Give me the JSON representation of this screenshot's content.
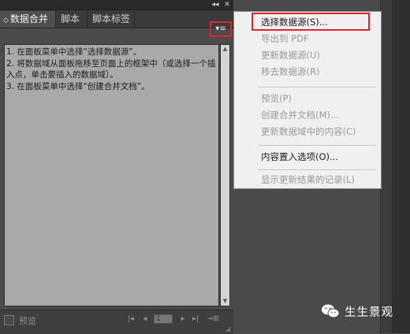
{
  "panel": {
    "collapse_icon": "◂◂",
    "close_icon": "✕",
    "tabs": [
      {
        "label": "数据合并",
        "arrows": "◇"
      },
      {
        "label": "脚本"
      },
      {
        "label": "脚本标签"
      }
    ],
    "menu_icon": "▾≡",
    "content_lines": [
      "1. 在面板菜单中选择“选择数据源”。",
      "2. 将数据域从面板拖移至页面上的框架中（或选择一个插入点，单击要插入的数据域）。",
      "3. 在面板菜单中选择“创建合并文档”。"
    ],
    "footer": {
      "preview_label": "预览",
      "record_value": "1",
      "first_icon": "|◂",
      "prev_icon": "◂",
      "next_icon": "▸",
      "last_icon": "▸|",
      "create_icon": "→⊞",
      "grip_icon": "◢"
    }
  },
  "menu": {
    "items": [
      {
        "label": "选择数据源(S)...",
        "enabled": true
      },
      {
        "label": "导出到 PDF",
        "enabled": false
      },
      {
        "label": "更新数据源(U)",
        "enabled": false
      },
      {
        "label": "移去数据源(R)",
        "enabled": false
      },
      {
        "label": "预览(P)",
        "enabled": false
      },
      {
        "label": "创建合并文档(M)...",
        "enabled": false
      },
      {
        "label": "更新数据域中的内容(C)",
        "enabled": false
      },
      {
        "label": "内容置入选项(O)...",
        "enabled": true
      },
      {
        "label": "显示更新结果的记录(L)",
        "enabled": false
      }
    ]
  },
  "watermark": {
    "text": "生生景观",
    "icon": "wechat-icon"
  },
  "colors": {
    "highlight": "#e0242a",
    "panel_bg": "#4b4b4b",
    "content_bg": "#a9a9a9",
    "menu_bg": "#f0f0f0"
  }
}
